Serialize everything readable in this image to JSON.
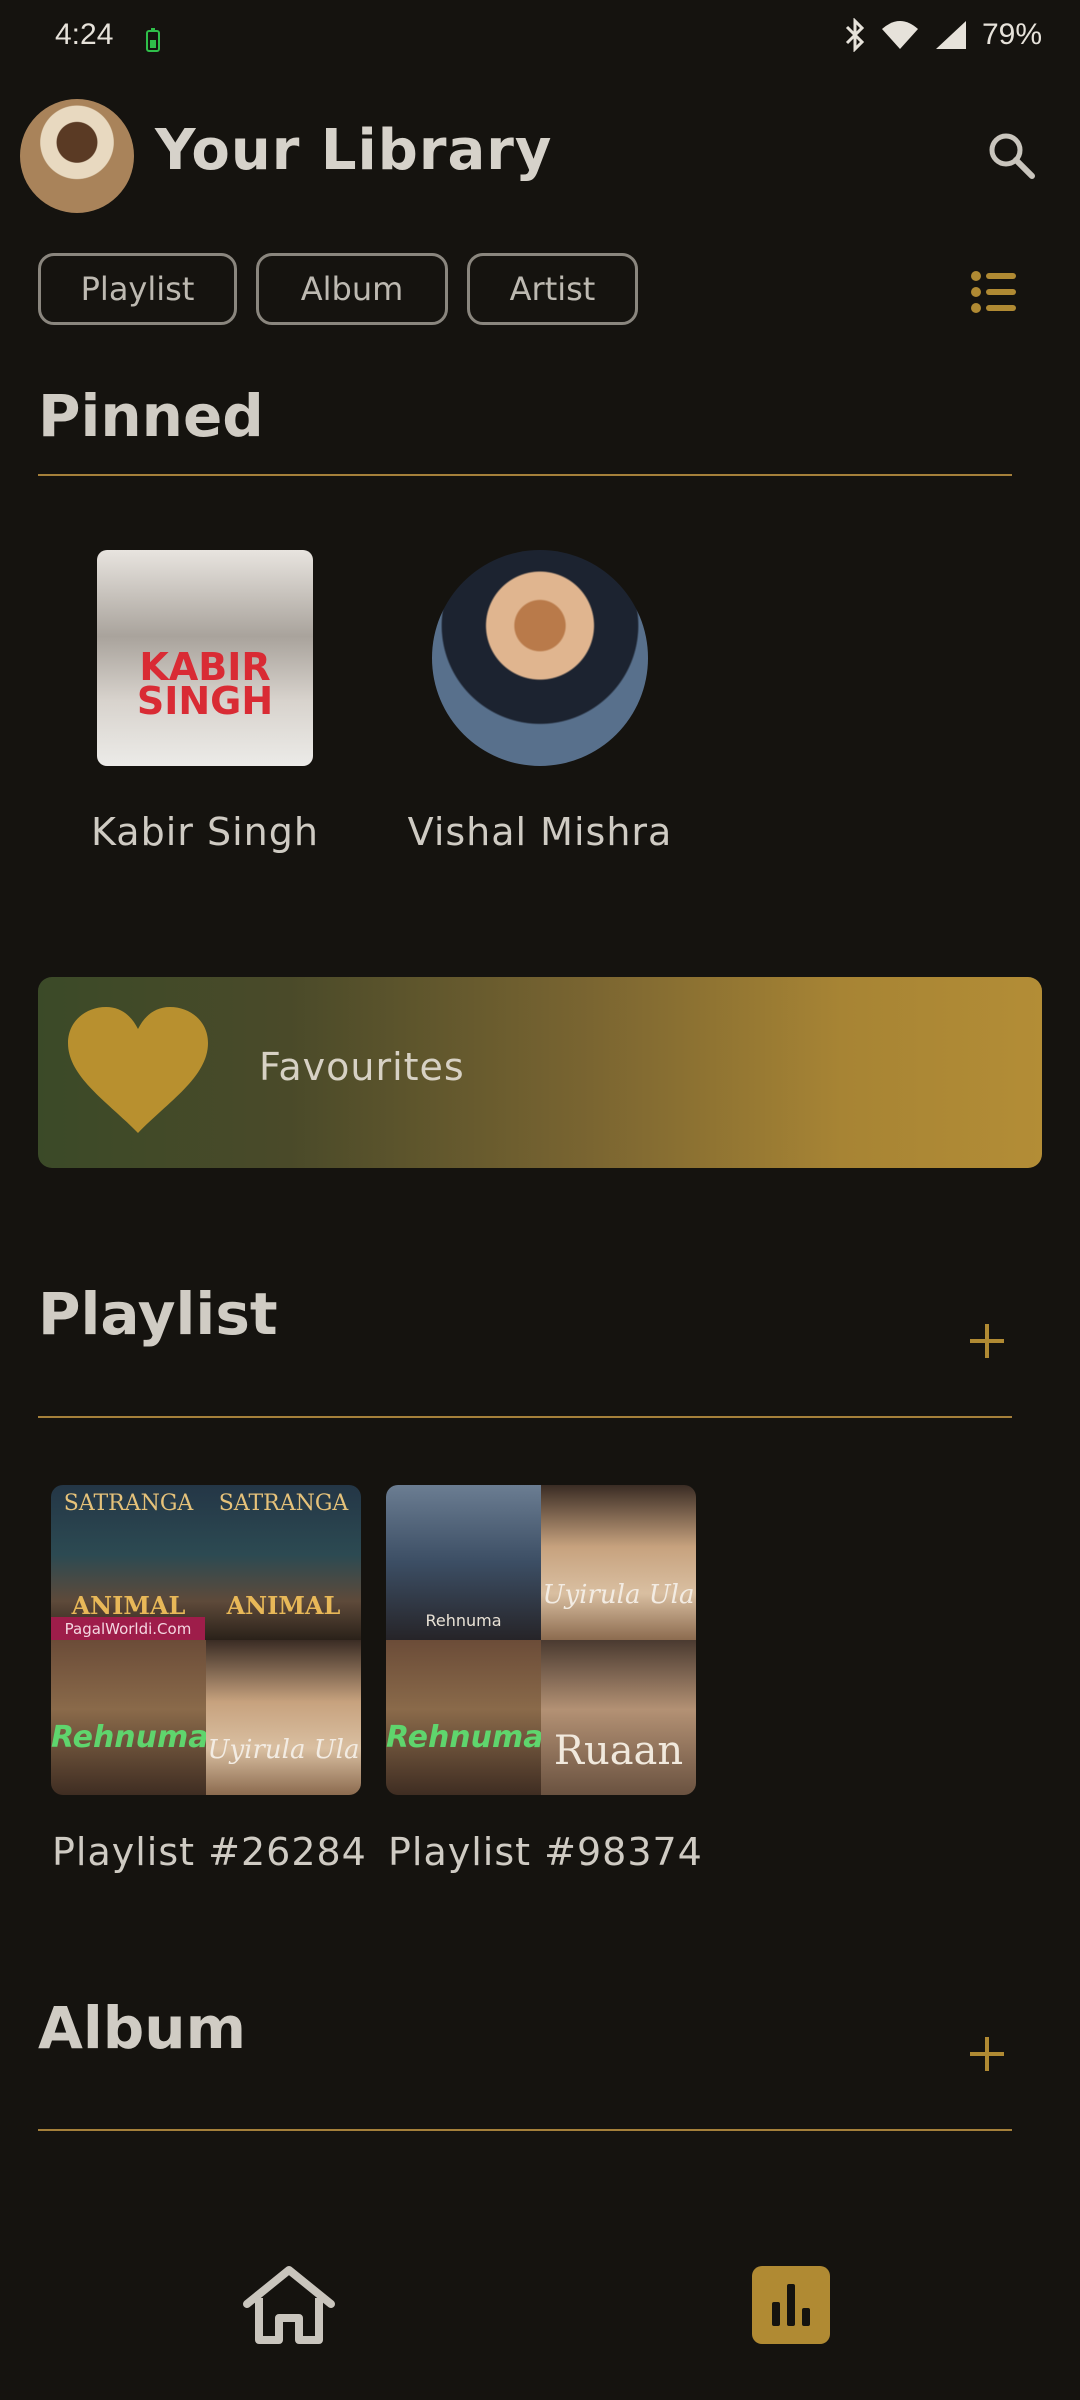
{
  "status_bar": {
    "time": "4:24",
    "battery": "79%"
  },
  "header": {
    "title": "Your Library"
  },
  "filters": {
    "chips": [
      "Playlist",
      "Album",
      "Artist"
    ]
  },
  "pinned": {
    "title": "Pinned",
    "items": [
      {
        "label": "Kabir Singh",
        "cover_text": "KABIR SINGH"
      },
      {
        "label": "Vishal Mishra"
      }
    ]
  },
  "favourites": {
    "label": "Favourites"
  },
  "playlists": {
    "title": "Playlist",
    "items": [
      {
        "label": "Playlist #26284",
        "tiles": [
          "SATRANGA",
          "ANIMAL",
          "SATRANGA",
          "ANIMAL",
          "Rehnuma",
          "Uyirula Ula",
          "PagalWorldi.Com"
        ]
      },
      {
        "label": "Playlist #98374",
        "tiles": [
          "Rehnuma",
          "Uyirula Ula",
          "Rehnuma",
          "Ruaan"
        ]
      }
    ]
  },
  "albums": {
    "title": "Album"
  },
  "colors": {
    "background": "#15130f",
    "accent": "#b08a33",
    "divider": "#a5803a"
  }
}
